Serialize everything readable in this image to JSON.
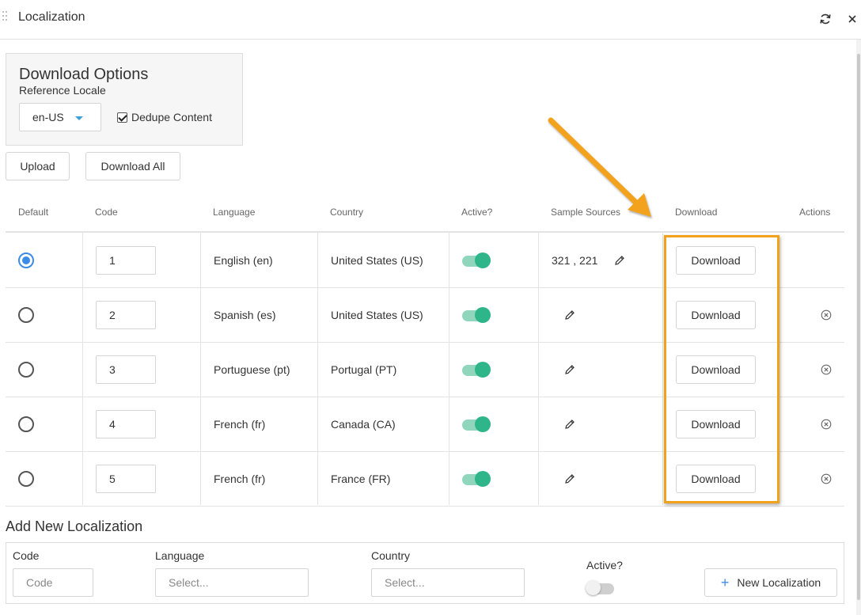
{
  "window": {
    "title": "Localization",
    "refresh_icon": "refresh-icon",
    "close_icon": "close-icon"
  },
  "download_options": {
    "title": "Download Options",
    "reference_locale_label": "Reference Locale",
    "reference_locale_value": "en-US",
    "dedupe_label": "Dedupe Content",
    "dedupe_checked": true
  },
  "toolbar": {
    "upload_label": "Upload",
    "download_all_label": "Download All"
  },
  "table": {
    "headers": [
      "Default",
      "Code",
      "Language",
      "Country",
      "Active?",
      "Sample Sources",
      "Download",
      "Actions"
    ],
    "rows": [
      {
        "default": true,
        "code": "1",
        "language": "English (en)",
        "country": "United States (US)",
        "active": true,
        "sample_sources": "321 , 221",
        "download_label": "Download",
        "removable": false
      },
      {
        "default": false,
        "code": "2",
        "language": "Spanish (es)",
        "country": "United States (US)",
        "active": true,
        "sample_sources": "",
        "download_label": "Download",
        "removable": true
      },
      {
        "default": false,
        "code": "3",
        "language": "Portuguese (pt)",
        "country": "Portugal (PT)",
        "active": true,
        "sample_sources": "",
        "download_label": "Download",
        "removable": true
      },
      {
        "default": false,
        "code": "4",
        "language": "French (fr)",
        "country": "Canada (CA)",
        "active": true,
        "sample_sources": "",
        "download_label": "Download",
        "removable": true
      },
      {
        "default": false,
        "code": "5",
        "language": "French (fr)",
        "country": "France (FR)",
        "active": true,
        "sample_sources": "",
        "download_label": "Download",
        "removable": true
      }
    ]
  },
  "add_new": {
    "title": "Add New Localization",
    "code_label": "Code",
    "code_placeholder": "Code",
    "language_label": "Language",
    "language_placeholder": "Select...",
    "country_label": "Country",
    "country_placeholder": "Select...",
    "active_label": "Active?",
    "active_value": false,
    "new_button_label": "New Localization"
  },
  "annotation": {
    "color": "#f2a21a"
  },
  "colors": {
    "accent_blue": "#3c8ce7",
    "toggle_green": "#2fb58a",
    "highlight_orange": "#f2a21a"
  }
}
